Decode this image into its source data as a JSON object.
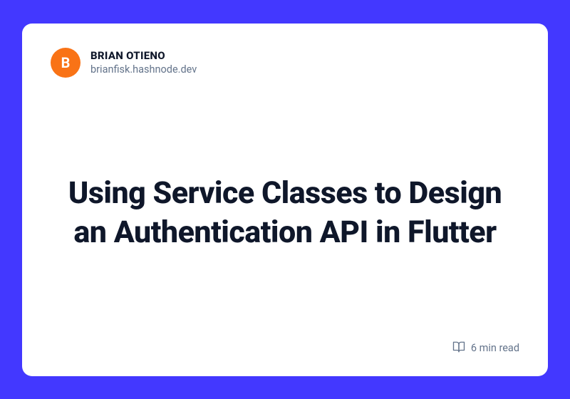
{
  "author": {
    "initial": "B",
    "name": "BRIAN OTIENO",
    "domain": "brianfisk.hashnode.dev"
  },
  "article": {
    "title": "Using Service Classes to Design an Authentication API in Flutter",
    "read_time": "6 min read"
  }
}
